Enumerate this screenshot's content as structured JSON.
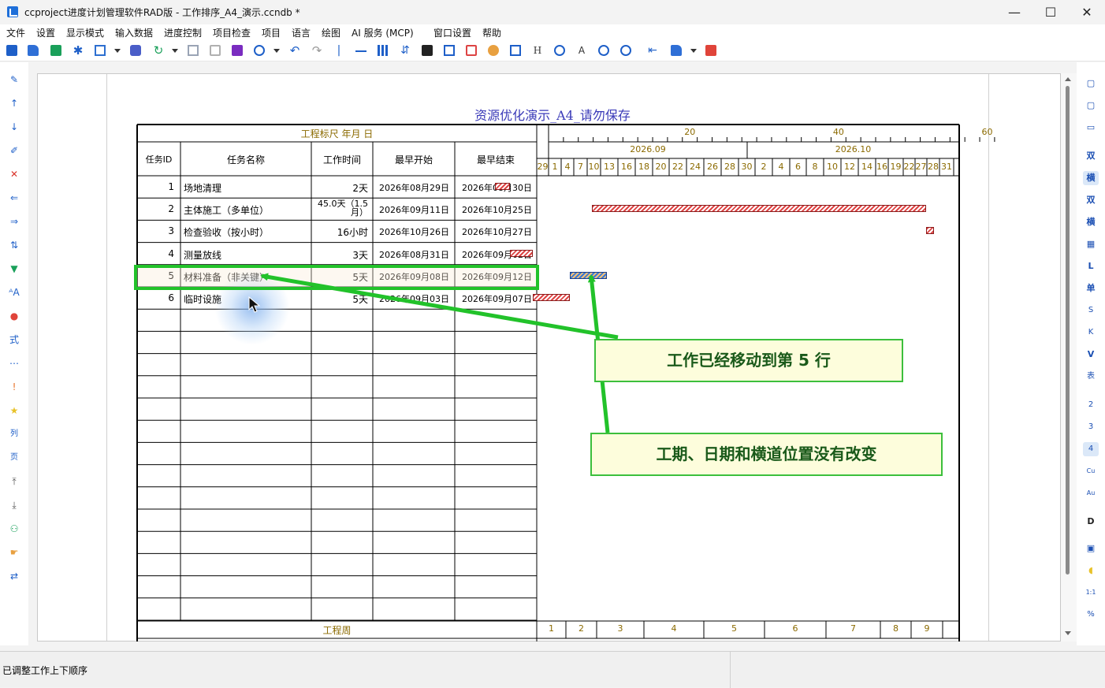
{
  "window": {
    "title": "ccproject进度计划管理软件RAD版 - 工作排序_A4_演示.ccndb *",
    "minimize": "—",
    "maximize": "☐",
    "close": "✕"
  },
  "menu": [
    "文件",
    "设置",
    "显示模式",
    "输入数据",
    "进度控制",
    "项目检查",
    "项目",
    "语言",
    "绘图",
    "AI 服务 (MCP)",
    "窗口设置",
    "帮助"
  ],
  "right_toolbar": [
    "双",
    "横",
    "双",
    "横",
    "",
    "L",
    "单",
    "S",
    "K",
    "V",
    "表",
    "2",
    "3",
    "4",
    "Cu",
    "Au",
    "D",
    "",
    "",
    "1:1",
    "%"
  ],
  "chart": {
    "title": "资源优化演示_A4_请勿保存",
    "ruler_label": "工程标尺 年月 日",
    "ruler_ticks": [
      "20",
      "40",
      "60"
    ],
    "months": [
      "2026.09",
      "2026.10"
    ],
    "days": [
      "29",
      "1",
      "4",
      "7",
      "10",
      "13",
      "16",
      "18",
      "20",
      "22",
      "24",
      "26",
      "28",
      "30",
      "2",
      "4",
      "6",
      "8",
      "10",
      "12",
      "14",
      "16",
      "19",
      "22",
      "27",
      "28",
      "31"
    ],
    "columns": [
      "任务ID",
      "任务名称",
      "工作时间",
      "最早开始",
      "最早结束"
    ],
    "rows": [
      {
        "id": "1",
        "name": "场地清理",
        "dur": "2天",
        "start": "2026年08月29日",
        "end": "2026年08月30日"
      },
      {
        "id": "2",
        "name": "主体施工（多单位）",
        "dur": "45.0天（1.5月）",
        "start": "2026年09月11日",
        "end": "2026年10月25日"
      },
      {
        "id": "3",
        "name": "检查验收（按小时）",
        "dur": "16小时",
        "start": "2026年10月26日",
        "end": "2026年10月27日"
      },
      {
        "id": "4",
        "name": "测量放线",
        "dur": "3天",
        "start": "2026年08月31日",
        "end": "2026年09月02日"
      },
      {
        "id": "5",
        "name": "材料准备（非关键）",
        "dur": "5天",
        "start": "2026年09月08日",
        "end": "2026年09月12日"
      },
      {
        "id": "6",
        "name": "临时设施",
        "dur": "5天",
        "start": "2026年09月03日",
        "end": "2026年09月07日"
      }
    ],
    "footer_label": "工程周",
    "weeks": [
      "1",
      "2",
      "3",
      "4",
      "5",
      "6",
      "7",
      "8",
      "9"
    ],
    "bar_color_critical": "#d44444",
    "bar_color_noncritical": "#3a79d6"
  },
  "callouts": {
    "moved": "工作已经移动到第 5 行",
    "unchanged": "工期、日期和横道位置没有改变"
  },
  "status": "已调整工作上下顺序"
}
